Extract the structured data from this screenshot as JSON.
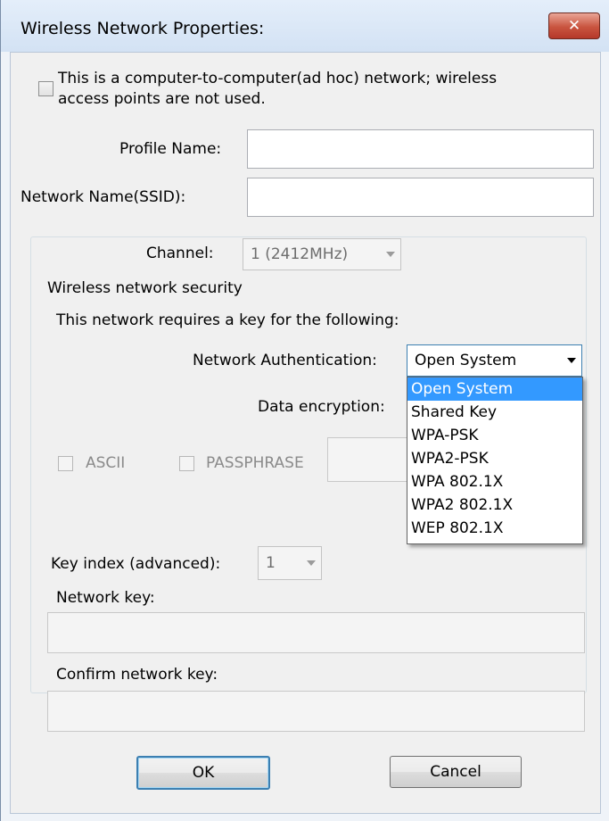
{
  "window": {
    "title": "Wireless Network Properties:",
    "close_glyph": "✕"
  },
  "adhoc": {
    "label_line1": "This is a computer-to-computer(ad hoc) network; wireless",
    "label_line2": "access points are not used.",
    "checked": false
  },
  "profile_name": {
    "label": "Profile Name:",
    "value": ""
  },
  "network_name": {
    "label": "Network Name(SSID):",
    "value": ""
  },
  "channel": {
    "label": "Channel:",
    "value": "1  (2412MHz)"
  },
  "security": {
    "group_title": "Wireless network security",
    "intro": "This network requires a key for the following:",
    "auth_label": "Network Authentication:",
    "auth_value": "Open System",
    "auth_options": [
      "Open System",
      "Shared Key",
      "WPA-PSK",
      "WPA2-PSK",
      "WPA 802.1X",
      "WPA2 802.1X",
      "WEP 802.1X"
    ],
    "encryption_label": "Data encryption:",
    "ascii_label": "ASCII",
    "passphrase_label": "PASSPHRASE",
    "key_index_label": "Key index (advanced):",
    "key_index_value": "1",
    "network_key_label": "Network key:",
    "confirm_key_label": "Confirm network key:"
  },
  "buttons": {
    "ok": "OK",
    "cancel": "Cancel"
  }
}
